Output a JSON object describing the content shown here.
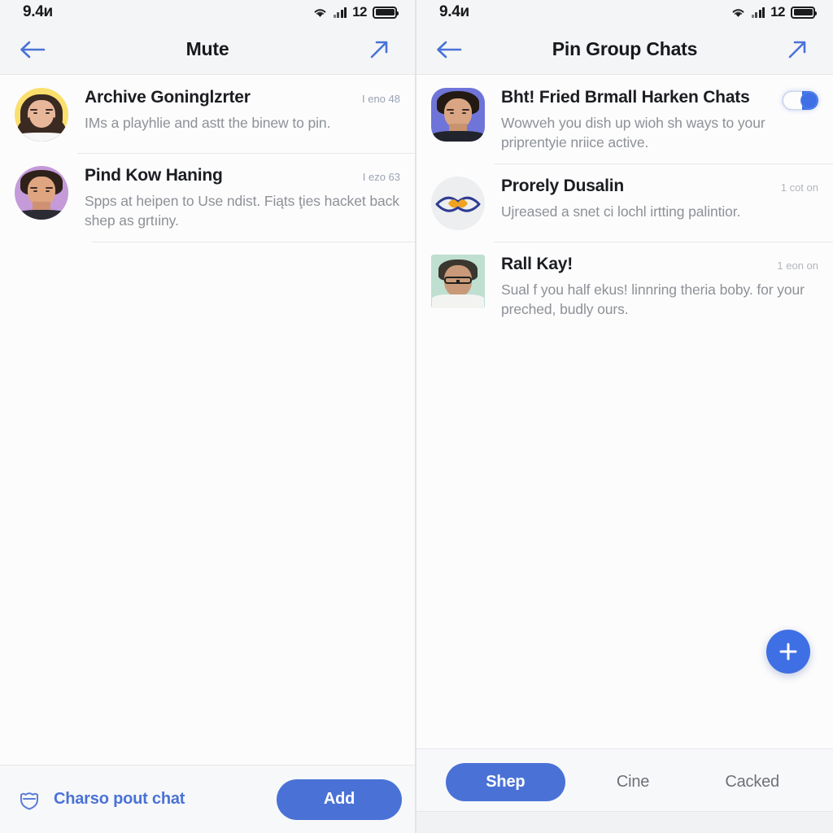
{
  "status_bar": {
    "time": "9.4и",
    "wifi_icon": "wifi-icon",
    "cellular_icon": "cellular-signal-icon",
    "battery_percent": "12",
    "battery_icon": "battery-icon"
  },
  "left_panel": {
    "nav": {
      "back_icon": "back-arrow-icon",
      "title": "Mute",
      "share_icon": "share-arrow-icon"
    },
    "rows": [
      {
        "avatar": "avatar-woman-yellow",
        "title": "Archive Goninglzrter",
        "meta": "I eno 48",
        "subtitle": "IMs a playhlie and astt the binew to pin."
      },
      {
        "avatar": "avatar-man-purple",
        "title": "Pind Kow Haning",
        "meta": "I ezo 63",
        "subtitle": "Spps at heipen to Use ndist. Fiąts ţies hacket back shep as grtıiny."
      }
    ],
    "bottom_bar": {
      "icon": "shield-badge-icon",
      "link_label": "Charso рout chat",
      "add_label": "Add"
    }
  },
  "right_panel": {
    "nav": {
      "back_icon": "back-arrow-icon",
      "title": "Pin Group Chats",
      "share_icon": "share-arrow-icon"
    },
    "rows": [
      {
        "avatar": "avatar-man-indigo",
        "title": "Bht! Fried Brmall Harken Chats",
        "meta": "",
        "subtitle": "Wowveh you dish up wioh sh ways to your priprentyie nriice active.",
        "toggle": "on"
      },
      {
        "avatar": "avatar-eye-logo",
        "title": "Prorely Dusalin",
        "meta": "1 cot on",
        "subtitle": "Ujreased a snet сi lochl irtting palintior.",
        "toggle": ""
      },
      {
        "avatar": "avatar-man-mint",
        "title": "Rall Kay!",
        "meta": "1 eon on",
        "subtitle": "Sual f you half ekus! linnring theriа boby. for your preched, budly ours.",
        "toggle": ""
      }
    ],
    "fab": {
      "icon": "plus-icon"
    },
    "segments": [
      {
        "label": "Shep",
        "active": true
      },
      {
        "label": "Cine",
        "active": false
      },
      {
        "label": "Cacked",
        "active": false
      }
    ]
  },
  "colors": {
    "accent": "#4a72d6",
    "toggle_on": "#3f6fe4",
    "fab": "#3f6fe4",
    "title_text": "#1b1d21",
    "subtitle_text": "#8d9197",
    "meta_blue": "#9aa3b5",
    "meta_grey": "#b3b6bb",
    "bar_background": "#f4f5f7",
    "panel_background": "#fcfcfc"
  }
}
